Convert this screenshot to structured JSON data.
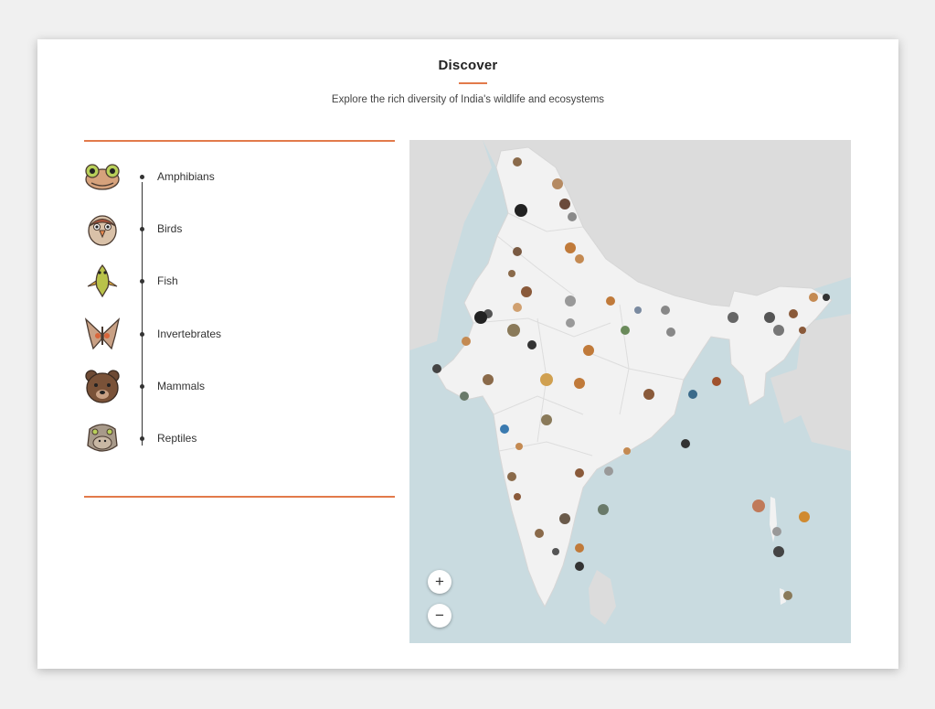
{
  "header": {
    "title": "Discover",
    "subtitle": "Explore the rich diversity of India's wildlife and ecosystems"
  },
  "categories": [
    {
      "label": "Amphibians",
      "icon": "frog-icon"
    },
    {
      "label": "Birds",
      "icon": "bird-icon"
    },
    {
      "label": "Fish",
      "icon": "fish-icon"
    },
    {
      "label": "Invertebrates",
      "icon": "butterfly-icon"
    },
    {
      "label": "Mammals",
      "icon": "bear-icon"
    },
    {
      "label": "Reptiles",
      "icon": "crocodile-icon"
    }
  ],
  "map": {
    "zoom_in_label": "+",
    "zoom_out_label": "−",
    "colors": {
      "sea": "#c9dbe0",
      "land": "#f2f2f2",
      "neighbors": "#dcdcdc",
      "accent": "#e27a4b"
    }
  }
}
